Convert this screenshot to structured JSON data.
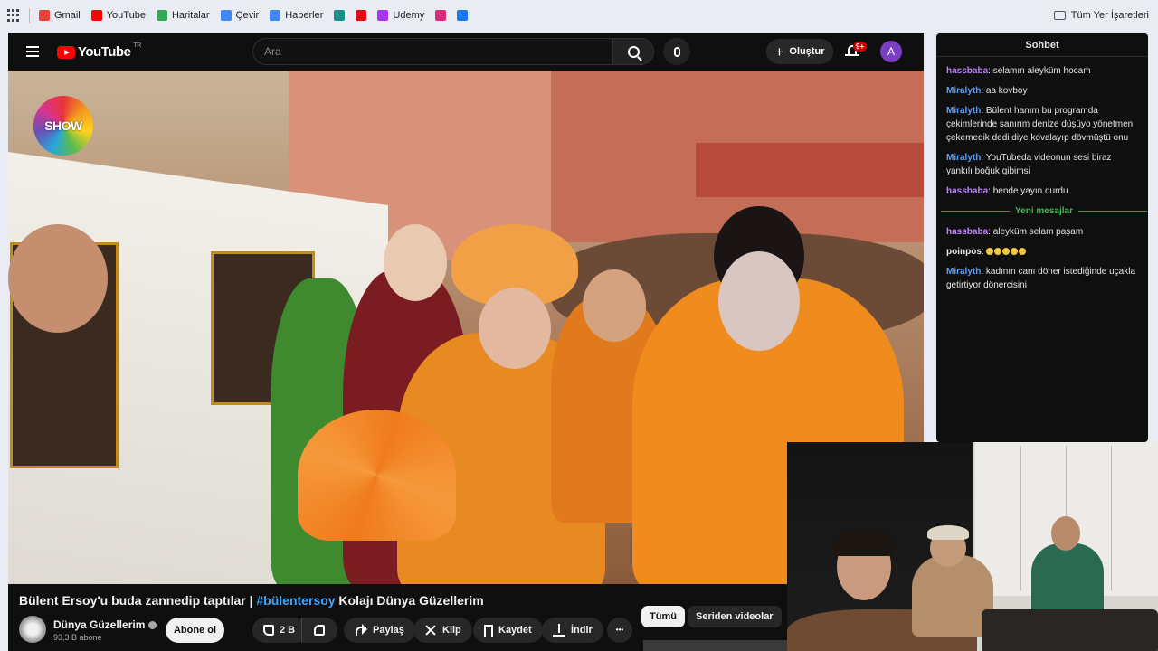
{
  "browser": {
    "bookmarks": [
      {
        "label": "Gmail",
        "icon": "gmail-icon",
        "color": "#ea4335"
      },
      {
        "label": "YouTube",
        "icon": "youtube-icon",
        "color": "#ff0000"
      },
      {
        "label": "Haritalar",
        "icon": "maps-icon",
        "color": "#34a853"
      },
      {
        "label": "Çevir",
        "icon": "translate-icon",
        "color": "#4285f4"
      },
      {
        "label": "Haberler",
        "icon": "news-icon",
        "color": "#4285f4"
      },
      {
        "label": "",
        "icon": "edge-icon",
        "color": "#1a8f8a"
      },
      {
        "label": "",
        "icon": "netflix-icon",
        "color": "#e50914"
      },
      {
        "label": "Udemy",
        "icon": "udemy-icon",
        "color": "#a435f0"
      },
      {
        "label": "",
        "icon": "instagram-icon",
        "color": "#dd2a7b"
      },
      {
        "label": "",
        "icon": "facebook-icon",
        "color": "#1877f2"
      }
    ],
    "all_bookmarks_label": "Tüm Yer İşaretleri"
  },
  "youtube": {
    "logo_text": "YouTube",
    "region": "TR",
    "search_placeholder": "Ara",
    "create_label": "Oluştur",
    "notification_count": "9+",
    "avatar_letter": "A",
    "video_overlay_logo": "SHOW"
  },
  "video": {
    "title_before": "Bülent Ersoy'u buda zannedip taptılar | ",
    "title_hashtag": "#bülentersoy",
    "title_after": " Kolajı Dünya Güzellerim",
    "channel_name": "Dünya Güzellerim",
    "subscribers": "93,3 B abone",
    "subscribe_label": "Abone ol",
    "like_count": "2 B",
    "share_label": "Paylaş",
    "clip_label": "Klip",
    "save_label": "Kaydet",
    "download_label": "İndir",
    "more_label": "•••",
    "chips": [
      "Tümü",
      "Seriden videolar"
    ]
  },
  "chat": {
    "title": "Sohbet",
    "messages_before": [
      {
        "user": "hassbaba",
        "color": "#c084fc",
        "text": "selamın aleyküm hocam"
      },
      {
        "user": "Miralyth",
        "color": "#5aa0ff",
        "text": "aa kovboy"
      },
      {
        "user": "Miralyth",
        "color": "#5aa0ff",
        "text": "Bülent hanım bu programda çekimlerinde sanırım denize düşüyo yönetmen çekemedik dedi diye kovalayıp dövmüştü onu"
      },
      {
        "user": "Miralyth",
        "color": "#5aa0ff",
        "text": "YouTubeda videonun sesi biraz yankılı boğuk gibimsi"
      },
      {
        "user": "hassbaba",
        "color": "#c084fc",
        "text": "bende yayın durdu"
      }
    ],
    "divider_label": "Yeni mesajlar",
    "messages_after": [
      {
        "user": "hassbaba",
        "color": "#c084fc",
        "text": "aleyküm selam paşam"
      },
      {
        "user": "poinpos",
        "color": "#e6e6e6",
        "text": ""
      },
      {
        "user": "Miralyth",
        "color": "#5aa0ff",
        "text": "kadının canı döner istediğinde uçakla getirtiyor dönercisini"
      }
    ]
  }
}
